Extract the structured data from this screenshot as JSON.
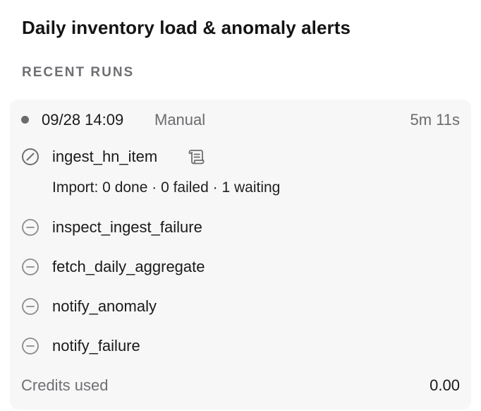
{
  "header": {
    "title": "Daily inventory load & anomaly alerts",
    "section_label": "RECENT RUNS"
  },
  "run": {
    "status_icon": "status-dot-icon",
    "timestamp": "09/28 14:09",
    "trigger": "Manual",
    "duration": "5m 11s",
    "steps": [
      {
        "label": "ingest_hn_item",
        "icon": "running-icon",
        "has_log_icon": true,
        "log_icon": "log-scroll-icon",
        "detail": "Import: 0 done · 0 failed · 1 waiting"
      },
      {
        "label": "inspect_ingest_failure",
        "icon": "pending-icon"
      },
      {
        "label": "fetch_daily_aggregate",
        "icon": "pending-icon"
      },
      {
        "label": "notify_anomaly",
        "icon": "pending-icon"
      },
      {
        "label": "notify_failure",
        "icon": "pending-icon"
      }
    ],
    "credits_label": "Credits used",
    "credits_value": "0.00"
  },
  "colors": {
    "card_background": "#f7f7f7",
    "muted_text": "#6f6f74",
    "icon_stroke": "#7a7a7a",
    "primary_text": "#1a1a1a"
  }
}
